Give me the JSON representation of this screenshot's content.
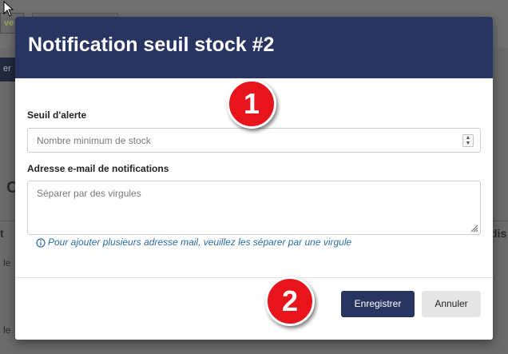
{
  "background": {
    "partial_text_1": "ve",
    "partial_button": "er",
    "partial_heading": "C",
    "partial_column_1": "t",
    "partial_row_1": "le",
    "partial_row_2": "le",
    "partial_column_2": "dis"
  },
  "modal": {
    "title": "Notification seuil stock #2",
    "threshold_label": "Seuil d'alerte",
    "threshold_placeholder": "Nombre minimum de stock",
    "email_label": "Adresse e-mail de notifications",
    "email_placeholder": "Séparer par des virgules",
    "hint": "Pour ajouter plusieurs adresse mail, veuillez les séparer par une virgule",
    "save_label": "Enregistrer",
    "cancel_label": "Annuler"
  },
  "annotations": {
    "badge_1": "1",
    "badge_2": "2"
  },
  "colors": {
    "header": "#283561",
    "primary_button": "#283561",
    "badge": "#e8141c",
    "hint": "#2a6ea5"
  },
  "icons": [
    "info-icon",
    "spinner-arrows-icon",
    "resize-grip-icon",
    "mouse-cursor-icon"
  ]
}
